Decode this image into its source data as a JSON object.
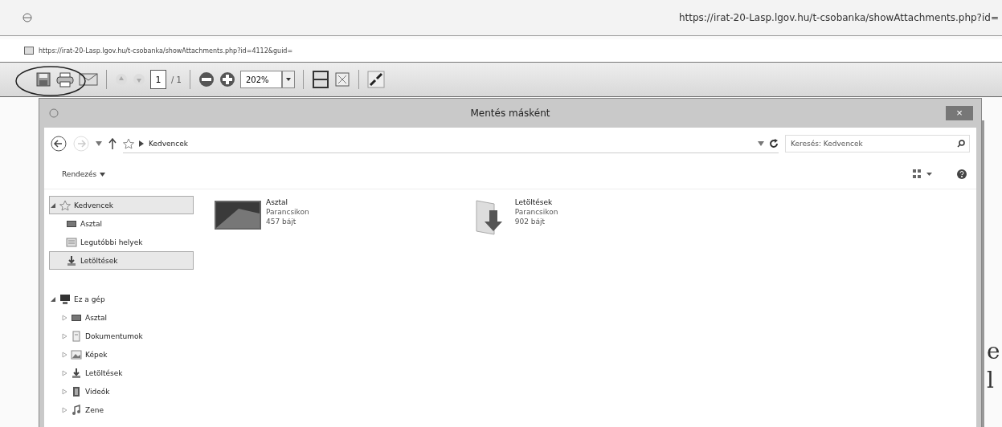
{
  "browser": {
    "title_url": "https://irat-20-Lasp.lgov.hu/t-csobanka/showAttachments.php?id=",
    "address": "https://irat-20-Lasp.lgov.hu/t-csobanka/showAttachments.php?id=4112&guid="
  },
  "pdf_toolbar": {
    "page": "1",
    "page_count": "/ 1",
    "zoom": "202%"
  },
  "dialog": {
    "title": "Mentés másként",
    "close": "×",
    "path": "Kedvencek",
    "search": {
      "placeholder": "Keresés: Kedvencek"
    },
    "organize": "Rendezés",
    "tree": [
      {
        "label": "Kedvencek",
        "kind": "star",
        "expanded": true,
        "selected": true,
        "children": [
          {
            "label": "Asztal",
            "kind": "desktop",
            "selected": false
          },
          {
            "label": "Legutóbbi helyek",
            "kind": "recent",
            "selected": false
          },
          {
            "label": "Letöltések",
            "kind": "download",
            "selected": true
          }
        ]
      },
      {
        "label": "Ez a gép",
        "kind": "computer",
        "expanded": true,
        "selected": false,
        "children": [
          {
            "label": "Asztal",
            "kind": "desktop",
            "selected": false,
            "expanded": false
          },
          {
            "label": "Dokumentumok",
            "kind": "documents",
            "selected": false,
            "expanded": false
          },
          {
            "label": "Képek",
            "kind": "pictures",
            "selected": false,
            "expanded": false
          },
          {
            "label": "Letöltések",
            "kind": "download",
            "selected": false,
            "expanded": false
          },
          {
            "label": "Videók",
            "kind": "videos",
            "selected": false,
            "expanded": false
          },
          {
            "label": "Zene",
            "kind": "music",
            "selected": false,
            "expanded": false
          }
        ]
      }
    ],
    "files": [
      {
        "name": "Asztal",
        "type": "Parancsikon",
        "size": "457 bájt",
        "kind": "desktop"
      },
      {
        "name": "Letöltések",
        "type": "Parancsikon",
        "size": "902 bájt",
        "kind": "download"
      }
    ]
  },
  "background_text": [
    "e",
    "l"
  ]
}
